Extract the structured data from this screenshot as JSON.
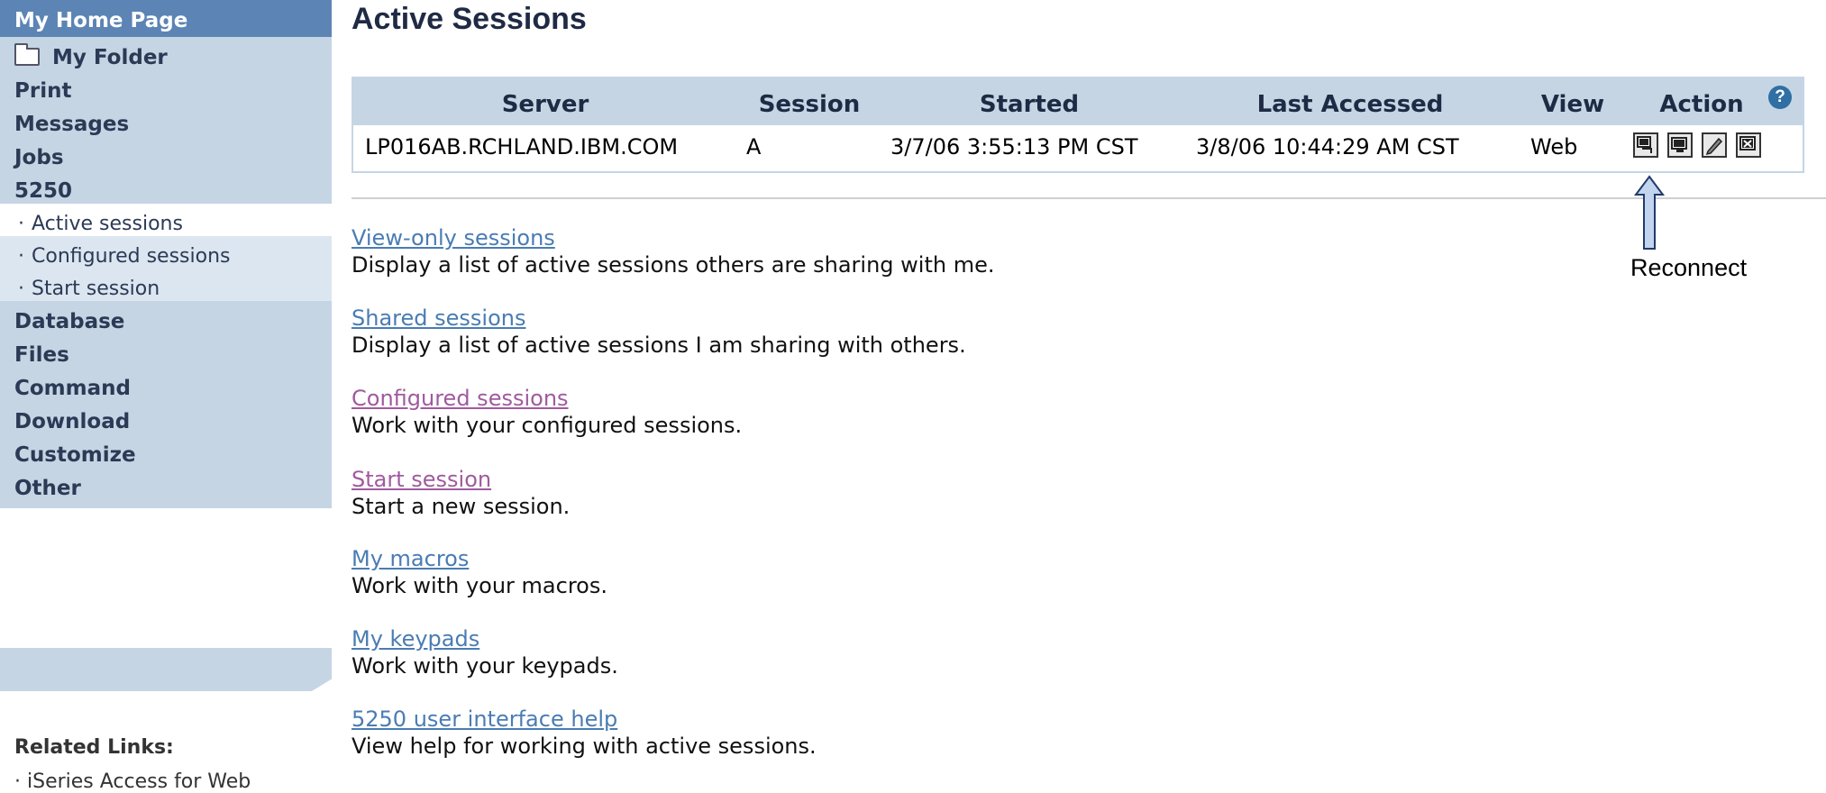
{
  "sidebar": {
    "home": "My Home Page",
    "folder": "My Folder",
    "items": [
      "Print",
      "Messages",
      "Jobs",
      "5250"
    ],
    "sub_items": [
      "Active sessions",
      "Configured sessions",
      "Start session"
    ],
    "items_after": [
      "Database",
      "Files",
      "Command",
      "Download",
      "Customize",
      "Other"
    ],
    "bullet": "·",
    "related_title": "Related Links:",
    "related_links": [
      "iSeries Access for Web"
    ]
  },
  "main": {
    "title": "Active Sessions",
    "table": {
      "headers": [
        "Server",
        "Session",
        "Started",
        "Last Accessed",
        "View",
        "Action"
      ],
      "help_icon_glyph": "?",
      "rows": [
        {
          "server": "LP016AB.RCHLAND.IBM.COM",
          "session": "A",
          "started": "3/7/06 3:55:13 PM CST",
          "last_accessed": "3/8/06 10:44:29 AM CST",
          "view": "Web"
        }
      ],
      "action_icons": [
        "reconnect-icon",
        "share-icon",
        "edit-icon",
        "stop-icon"
      ]
    },
    "links": [
      {
        "label": "View-only sessions",
        "desc": "Display a list of active sessions others are sharing with me."
      },
      {
        "label": "Shared sessions",
        "desc": "Display a list of active sessions I am sharing with others."
      },
      {
        "label": "Configured sessions",
        "desc": "Work with your configured sessions."
      },
      {
        "label": "Start session",
        "desc": "Start a new session."
      },
      {
        "label": "My macros",
        "desc": "Work with your macros."
      },
      {
        "label": "My keypads",
        "desc": "Work with your keypads."
      },
      {
        "label": "5250 user interface help",
        "desc": "View help for working with active sessions."
      }
    ]
  },
  "annotation": {
    "label": "Reconnect"
  },
  "colors": {
    "nav_bg": "#c5d5e4",
    "home_bg": "#5c84b5",
    "link": "#4a7cb3",
    "visited_link": "#a05a9e",
    "help_icon": "#2f6fa3"
  }
}
